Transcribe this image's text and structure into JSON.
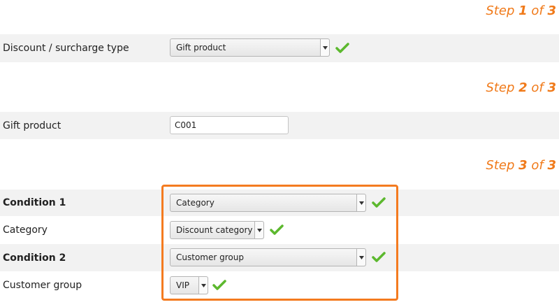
{
  "steps": [
    {
      "prefix": "Step ",
      "num": "1",
      "suffix": " of ",
      "total": "3"
    },
    {
      "prefix": "Step ",
      "num": "2",
      "suffix": " of ",
      "total": "3"
    },
    {
      "prefix": "Step ",
      "num": "3",
      "suffix": " of ",
      "total": "3"
    }
  ],
  "fields": {
    "type_label": "Discount / surcharge type",
    "type_value": "Gift product",
    "gift_label": "Gift product",
    "gift_value": "C001",
    "cond1_label": "Condition 1",
    "cond1_value": "Category",
    "category_label": "Category",
    "category_value": "Discount category",
    "cond2_label": "Condition 2",
    "cond2_value": "Customer group",
    "group_label": "Customer group",
    "group_value": "VIP"
  },
  "icons": {
    "valid": "checkmark-icon",
    "dropdown": "chevron-down-icon"
  },
  "colors": {
    "accent": "#f07a1a",
    "check": "#5cb82e",
    "highlight": "#f47b20"
  }
}
